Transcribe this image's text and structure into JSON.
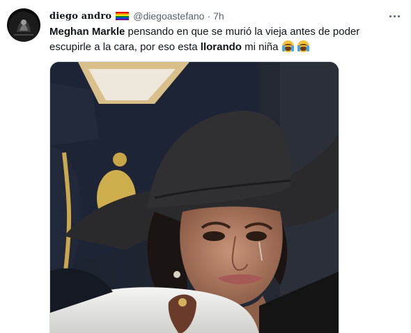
{
  "author": {
    "display_name": "diego andro",
    "handle": "@diegoastefano",
    "separator": "·",
    "time": "7h"
  },
  "tweet": {
    "bold1": "Meghan Markle",
    "text1": " pensando en que se murió la vieja antes de poder escupirle a la cara, por eso esta ",
    "bold2": "llorando",
    "text2": " mi niña "
  },
  "icons": {
    "avatar": "profile-avatar",
    "flag": "rainbow-flag-emoji",
    "more": "more-options-icon",
    "emoji": "loudly-crying-face-emoji"
  },
  "colors": {
    "secondary_text": "#536471",
    "primary_text": "#0f1419",
    "border": "#cfd9de"
  }
}
